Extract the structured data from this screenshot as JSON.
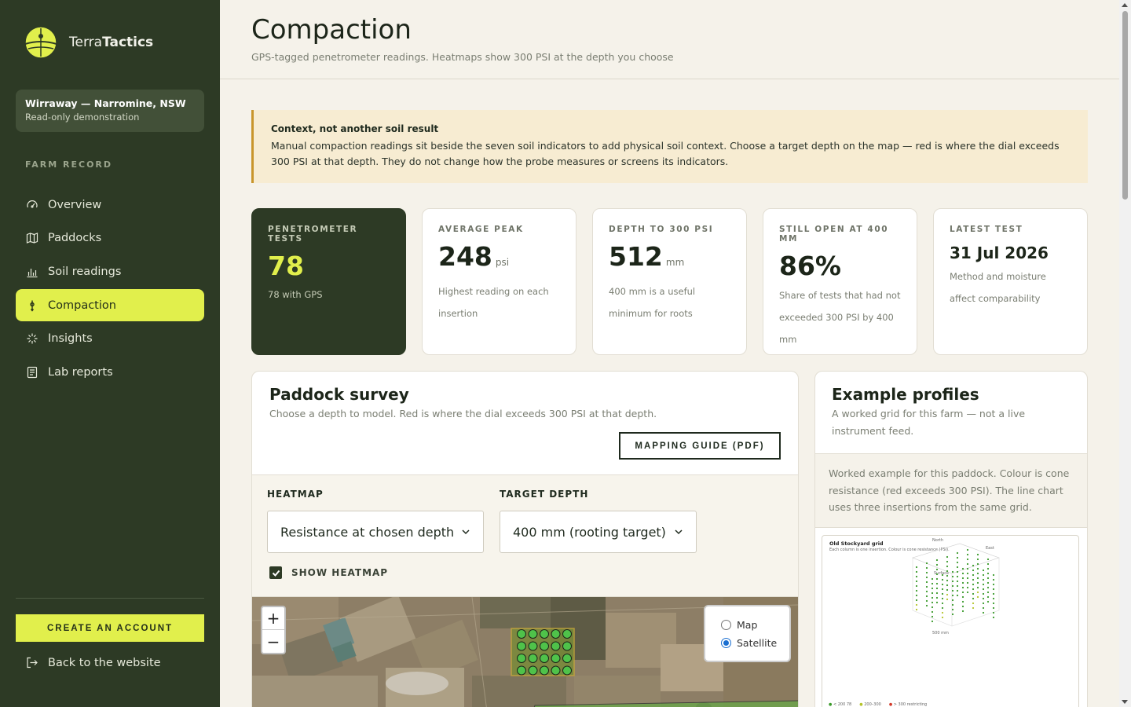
{
  "sidebar": {
    "brand_light": "Terra",
    "brand_bold": "Tactics",
    "farm_name": "Wirraway — Narromine, NSW",
    "farm_sub": "Read-only demonstration",
    "section_label": "FARM RECORD",
    "nav": [
      {
        "label": "Overview",
        "icon": "overview-icon"
      },
      {
        "label": "Paddocks",
        "icon": "map-icon"
      },
      {
        "label": "Soil readings",
        "icon": "bar-chart-icon"
      },
      {
        "label": "Compaction",
        "icon": "probe-icon",
        "active": true
      },
      {
        "label": "Insights",
        "icon": "sparkle-icon"
      },
      {
        "label": "Lab reports",
        "icon": "document-icon"
      }
    ],
    "cta_label": "CREATE AN ACCOUNT",
    "back_label": "Back to the website"
  },
  "header": {
    "title": "Compaction",
    "subtitle": "GPS-tagged penetrometer readings. Heatmaps show 300 PSI at the depth you choose"
  },
  "notice": {
    "title": "Context, not another soil result",
    "body": "Manual compaction readings sit beside the seven soil indicators to add physical soil context. Choose a target depth on the map — red is where the dial exceeds 300 PSI at that depth. They do not change how the probe measures or screens its indicators."
  },
  "stats": [
    {
      "label": "PENETROMETER TESTS",
      "value": "78",
      "unit": "",
      "note": "78 with GPS"
    },
    {
      "label": "AVERAGE PEAK",
      "value": "248",
      "unit": "psi",
      "note": "Highest reading on each insertion"
    },
    {
      "label": "DEPTH TO 300 PSI",
      "value": "512",
      "unit": "mm",
      "note": "400 mm is a useful minimum for roots"
    },
    {
      "label": "STILL OPEN AT 400 MM",
      "value": "86%",
      "unit": "",
      "note": "Share of tests that had not exceeded 300 PSI by 400 mm"
    },
    {
      "label": "LATEST TEST",
      "value": "31 Jul 2026",
      "unit": "",
      "note": "Method and moisture affect comparability"
    }
  ],
  "survey": {
    "title": "Paddock survey",
    "subtitle": "Choose a depth to model. Red is where the dial exceeds 300 PSI at that depth.",
    "guide_button": "MAPPING GUIDE (PDF)",
    "heatmap_label": "HEATMAP",
    "heatmap_value": "Resistance at chosen depth",
    "depth_label": "TARGET DEPTH",
    "depth_value": "400 mm (rooting target)",
    "show_heatmap_label": "SHOW HEATMAP",
    "show_heatmap_checked": true,
    "zoom_in": "+",
    "zoom_out": "−",
    "layer_map": "Map",
    "layer_satellite": "Satellite",
    "selected_layer": "Satellite"
  },
  "profiles": {
    "title": "Example profiles",
    "subtitle": "A worked grid for this farm — not a live instrument feed.",
    "note": "Worked example for this paddock. Colour is cone resistance (red exceeds 300 PSI). The line chart uses three insertions from the same grid.",
    "figure": {
      "title": "Old Stockyard grid",
      "subtitle": "Each column is one insertion. Colour is cone resistance (PSI).",
      "north": "North",
      "east": "East",
      "surface": "Surface",
      "depth": "500 mm",
      "legend": [
        "< 200 78",
        "200–300",
        "> 300 restricting"
      ]
    }
  },
  "colors": {
    "sidebar_bg": "#2d3a25",
    "accent": "#e1ef4c",
    "notice_border": "#c8952b"
  }
}
